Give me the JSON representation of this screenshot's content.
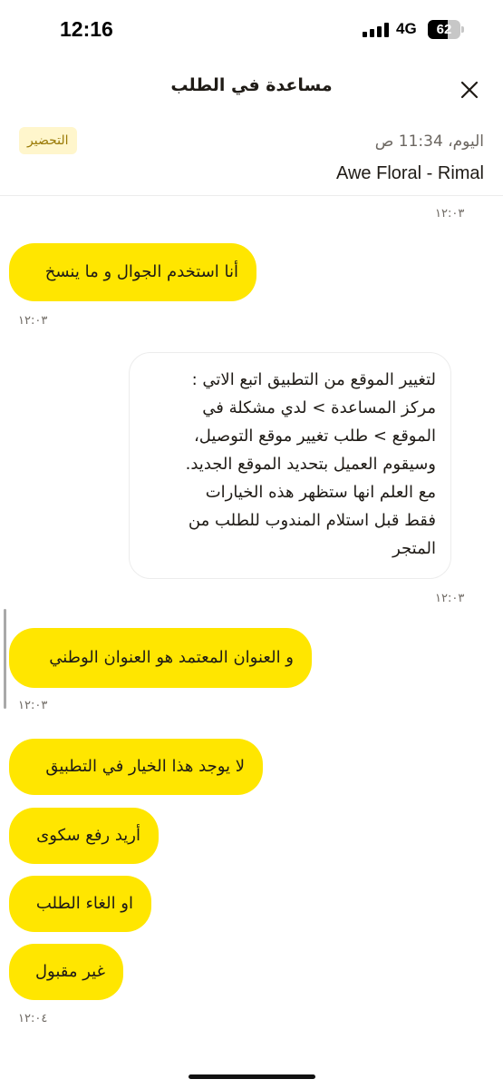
{
  "status_bar": {
    "time": "12:16",
    "network": "4G",
    "battery": "62",
    "battery_level": 0.62
  },
  "header": {
    "title": "مساعدة في الطلب"
  },
  "order": {
    "date": "اليوم، 11:34 ص",
    "status": "التحضير",
    "store": "Awe Floral - Rimal"
  },
  "chat": {
    "timestamps": {
      "t1": "١٢:٠٣",
      "t2": "١٢:٠٣",
      "t3": "١٢:٠٣",
      "t4": "١٢:٠٣",
      "t5": "١٢:٠٤"
    },
    "messages": {
      "m1": "أنا استخدم الجوال و ما ينسخ",
      "agent_lines": [
        "لتغيير الموقع من التطبيق اتبع الاتي :",
        "مركز المساعدة > لدي مشكلة في",
        "الموقع > طلب تغيير موقع التوصيل،",
        "وسيقوم العميل بتحديد الموقع الجديد.",
        "مع العلم انها ستظهر هذه الخيارات",
        "فقط قبل استلام المندوب للطلب من",
        "المتجر"
      ],
      "m3": "و العنوان المعتمد هو العنوان الوطني",
      "m4": "لا يوجد هذا الخيار في التطبيق",
      "m5": "أريد رفع سكوى",
      "m6": "او الغاء الطلب",
      "m7": "غير مقبول"
    }
  },
  "colors": {
    "user_bubble": "#ffe600",
    "status_badge_bg": "#fff6cc",
    "status_badge_text": "#9a7a06"
  },
  "icons": {
    "close": "close-icon",
    "signal": "cellular-signal-icon",
    "battery": "battery-icon"
  }
}
